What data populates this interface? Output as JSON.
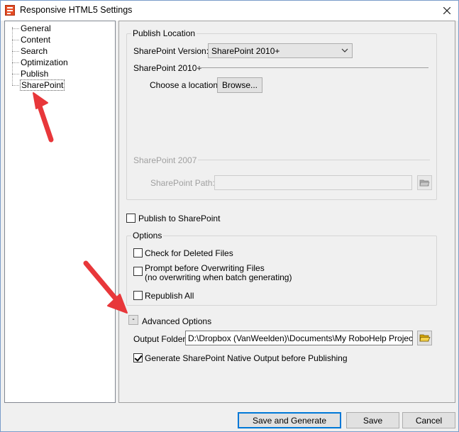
{
  "window": {
    "title": "Responsive HTML5 Settings"
  },
  "tree": {
    "items": [
      "General",
      "Content",
      "Search",
      "Optimization",
      "Publish",
      "SharePoint"
    ],
    "selected": "SharePoint"
  },
  "publish_location": {
    "legend": "Publish Location",
    "version_label": "SharePoint Version:",
    "version_value": "SharePoint 2010+",
    "sp2010_header": "SharePoint 2010+",
    "choose_location_label": "Choose a location:",
    "browse_label": "Browse...",
    "sp2007_header": "SharePoint 2007",
    "sp_path_label": "SharePoint Path:",
    "sp_path_value": ""
  },
  "publish_to_sharepoint": {
    "label": "Publish to SharePoint",
    "checked": false
  },
  "options": {
    "legend": "Options",
    "check_deleted": "Check for Deleted Files",
    "prompt_overwrite": "Prompt before Overwriting Files",
    "prompt_overwrite_note": "(no overwriting when batch generating)",
    "republish_all": "Republish All"
  },
  "advanced": {
    "toggle": "-",
    "label": "Advanced Options",
    "output_folder_label": "Output Folder:",
    "output_folder_value": "D:\\Dropbox (VanWeelden)\\Documents\\My RoboHelp Projects\\Ad",
    "generate_native_label": "Generate SharePoint Native Output before Publishing",
    "generate_native_checked": true
  },
  "footer": {
    "save_generate": "Save and Generate",
    "save": "Save",
    "cancel": "Cancel"
  },
  "colors": {
    "accent": "#0078d7",
    "arrow": "#e8373a"
  },
  "icons": [
    "app-icon",
    "close-icon",
    "dropdown-caret-icon",
    "folder-icon",
    "annotation-arrow-icon"
  ]
}
